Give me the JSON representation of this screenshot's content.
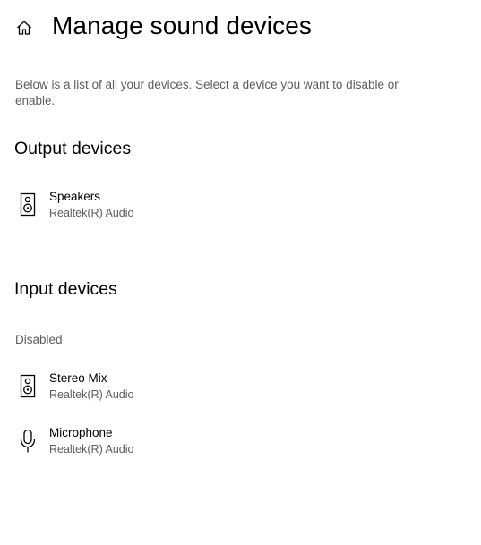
{
  "header": {
    "home_icon": "home-icon",
    "title": "Manage sound devices"
  },
  "description": "Below is a list of all your devices. Select a device you want to disable or enable.",
  "output_section": {
    "heading": "Output devices",
    "devices": [
      {
        "name": "Speakers",
        "subtitle": "Realtek(R) Audio",
        "icon": "speaker-icon"
      }
    ]
  },
  "input_section": {
    "heading": "Input devices",
    "subheading": "Disabled",
    "devices": [
      {
        "name": "Stereo Mix",
        "subtitle": "Realtek(R) Audio",
        "icon": "speaker-icon"
      },
      {
        "name": "Microphone",
        "subtitle": "Realtek(R) Audio",
        "icon": "microphone-icon"
      }
    ]
  }
}
